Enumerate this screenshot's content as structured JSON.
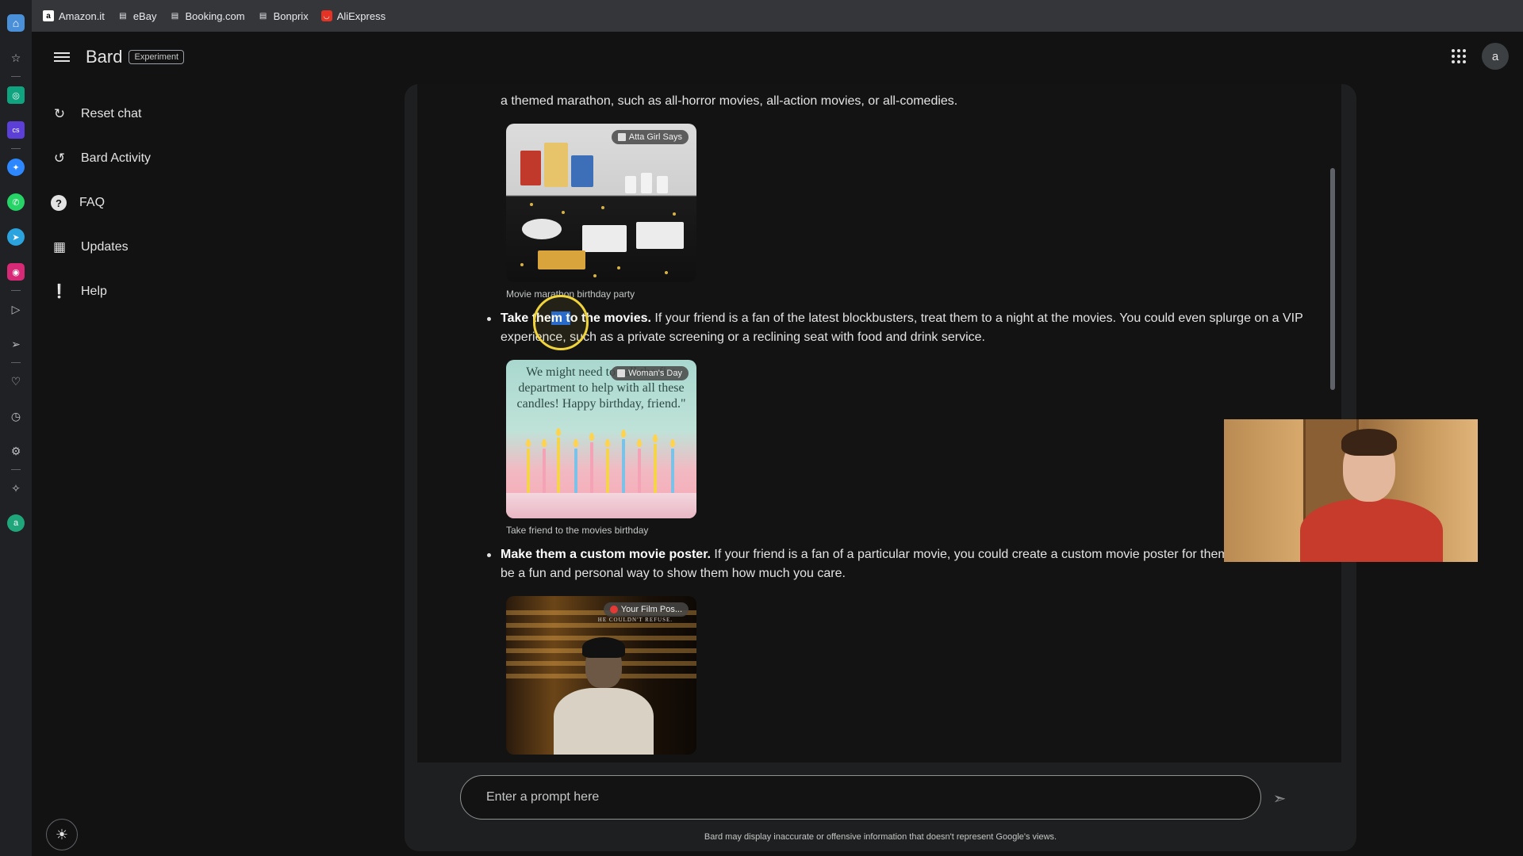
{
  "bookmarks": [
    {
      "label": "Amazon.it",
      "icon": "amazon-icon"
    },
    {
      "label": "eBay",
      "icon": "page-icon"
    },
    {
      "label": "Booking.com",
      "icon": "page-icon"
    },
    {
      "label": "Bonprix",
      "icon": "page-icon"
    },
    {
      "label": "AliExpress",
      "icon": "aliexpress-icon"
    }
  ],
  "header": {
    "brand": "Bard",
    "badge": "Experiment",
    "avatar_letter": "a"
  },
  "nav": {
    "items": [
      {
        "label": "Reset chat",
        "icon": "reset-icon"
      },
      {
        "label": "Bard Activity",
        "icon": "history-icon"
      },
      {
        "label": "FAQ",
        "icon": "question-icon"
      },
      {
        "label": "Updates",
        "icon": "calendar-icon"
      },
      {
        "label": "Help",
        "icon": "feedback-icon"
      }
    ]
  },
  "chat": {
    "intro_line2": "a themed marathon, such as all-horror movies, all-action movies, or all-comedies.",
    "image1": {
      "source": "Atta Girl Says",
      "caption": "Movie marathon birthday party"
    },
    "bullet2": {
      "bold_a": "Take the",
      "bold_sel": "m t",
      "bold_b": "o the movies.",
      "line1": " If your friend is a fan of the latest blockbusters, treat them to a night at the movies. You could even splurge on a VIP",
      "line2": "experience, such as a private screening or a reclining seat with food and drink service."
    },
    "image2": {
      "source": "Woman's Day",
      "quote": "We might need to call the fire department to help with all these candles! Happy birthday, friend.\"",
      "caption": "Take friend to the movies birthday"
    },
    "bullet3": {
      "bold": "Make them a custom movie poster.",
      "line1": " If your friend is a fan of a particular movie, you could create a custom movie poster for them",
      "line2": "be a fun and personal way to show them how much you care."
    },
    "image3": {
      "source": "Your Film Pos...",
      "poster_text": "HE COULDN'T REFUSE."
    }
  },
  "prompt": {
    "placeholder": "Enter a prompt here",
    "disclaimer": "Bard may display inaccurate or offensive information that doesn't represent Google's views."
  },
  "colors": {
    "background": "#121212",
    "panel": "#1e1f20",
    "selection": "#1a62d6",
    "cursor_highlight": "#f0d43a"
  }
}
